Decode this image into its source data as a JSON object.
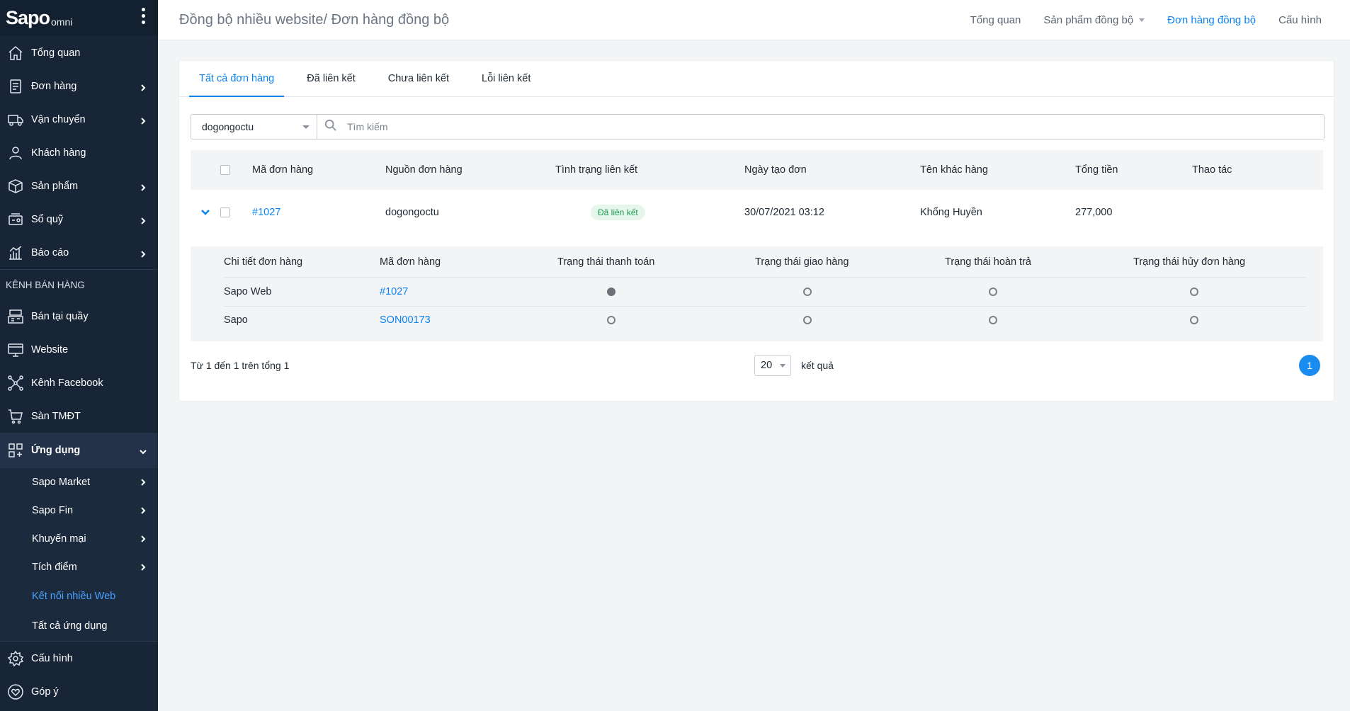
{
  "brand": {
    "logo": "Sapo",
    "logo_sub": "omni"
  },
  "sidebar": {
    "items": [
      {
        "label": "Tổng quan",
        "icon": "home-icon",
        "chevron": false
      },
      {
        "label": "Đơn hàng",
        "icon": "order-icon",
        "chevron": true
      },
      {
        "label": "Vận chuyển",
        "icon": "truck-icon",
        "chevron": true
      },
      {
        "label": "Khách hàng",
        "icon": "user-icon",
        "chevron": false
      },
      {
        "label": "Sản phẩm",
        "icon": "box-icon",
        "chevron": true
      },
      {
        "label": "Sổ quỹ",
        "icon": "cashbook-icon",
        "chevron": true
      },
      {
        "label": "Báo cáo",
        "icon": "report-icon",
        "chevron": true
      }
    ],
    "section_title": "KÊNH BÁN HÀNG",
    "channels": [
      {
        "label": "Bán tại quầy",
        "icon": "pos-icon"
      },
      {
        "label": "Website",
        "icon": "website-icon"
      },
      {
        "label": "Kênh Facebook",
        "icon": "facebook-channel-icon"
      },
      {
        "label": "Sàn TMĐT",
        "icon": "marketplace-icon"
      }
    ],
    "apps": {
      "label": "Ứng dụng",
      "icon": "apps-icon",
      "children": [
        {
          "label": "Sapo Market",
          "chevron": true
        },
        {
          "label": "Sapo Fin",
          "chevron": true
        },
        {
          "label": "Khuyến mại",
          "chevron": true
        },
        {
          "label": "Tích điểm",
          "chevron": true
        },
        {
          "label": "Kết nối nhiều Web",
          "chevron": false,
          "current": true
        },
        {
          "label": "Tất cả ứng dụng",
          "chevron": false
        }
      ]
    },
    "bottom": [
      {
        "label": "Cấu hình",
        "icon": "settings-icon"
      },
      {
        "label": "Góp ý",
        "icon": "feedback-icon"
      }
    ]
  },
  "header": {
    "title": "Đồng bộ nhiều website/ Đơn hàng đồng bộ",
    "nav": [
      "Tổng quan",
      "Sản phẩm đồng bộ",
      "Đơn hàng đồng bộ",
      "Cấu hình"
    ]
  },
  "tabs": [
    "Tất cả đơn hàng",
    "Đã liên kết",
    "Chưa liên kết",
    "Lỗi liên kết"
  ],
  "filter": {
    "store": "dogongoctu",
    "search_placeholder": "Tìm kiếm"
  },
  "table": {
    "headers": [
      "Mã đơn hàng",
      "Nguồn đơn hàng",
      "Tình trạng liên kết",
      "Ngày tạo đơn",
      "Tên khác hàng",
      "Tổng tiền",
      "Thao tác"
    ],
    "row": {
      "order_code": "#1027",
      "source": "dogongoctu",
      "link_status": "Đã liên kết",
      "created": "30/07/2021 03:12",
      "customer": "Khổng Huyền",
      "total": "277,000"
    }
  },
  "detail": {
    "headers": [
      "Chi tiết đơn hàng",
      "Mã đơn hàng",
      "Trạng thái thanh toán",
      "Trạng thái giao hàng",
      "Trạng thái hoàn trả",
      "Trạng thái hủy đơn hàng"
    ],
    "rows": [
      {
        "channel": "Sapo Web",
        "code": "#1027",
        "payment_done": true,
        "shipping_done": false,
        "return_done": false,
        "cancel_done": false
      },
      {
        "channel": "Sapo",
        "code": "SON00173",
        "payment_done": false,
        "shipping_done": false,
        "return_done": false,
        "cancel_done": false
      }
    ]
  },
  "footer": {
    "summary": "Từ 1 đến 1 trên tổng 1",
    "page_size": "20",
    "results_label": "kết quả",
    "current_page": "1"
  },
  "colors": {
    "sidebar_bg": "#182537",
    "accent": "#0b82f0",
    "badge_green": "#1a9e4e"
  }
}
